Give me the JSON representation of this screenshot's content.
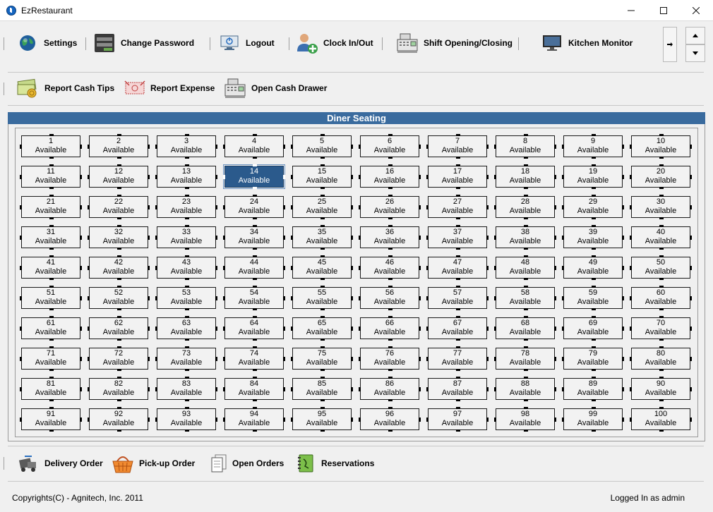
{
  "window": {
    "title": "EzRestaurant"
  },
  "toolbar1": [
    {
      "id": "settings",
      "label": "Settings",
      "icon": "globe-icon"
    },
    {
      "id": "change-password",
      "label": "Change Password",
      "icon": "password-panel-icon"
    },
    {
      "id": "logout",
      "label": "Logout",
      "icon": "monitor-power-icon"
    },
    {
      "id": "clock-in-out",
      "label": "Clock In/Out",
      "icon": "user-add-icon"
    },
    {
      "id": "shift",
      "label": "Shift Opening/Closing",
      "icon": "cash-register-icon"
    },
    {
      "id": "kitchen-monitor",
      "label": "Kitchen Monitor",
      "icon": "monitor-icon"
    }
  ],
  "toolbar2": [
    {
      "id": "report-cash-tips",
      "label": "Report Cash Tips",
      "icon": "cash-bills-icon"
    },
    {
      "id": "report-expense",
      "label": "Report Expense",
      "icon": "expense-bill-icon"
    },
    {
      "id": "open-cash-drawer",
      "label": "Open Cash Drawer",
      "icon": "cash-register-icon"
    }
  ],
  "seating": {
    "title": "Diner Seating",
    "status_label": "Available",
    "table_count": 100,
    "selected_table": 14
  },
  "toolbar3": [
    {
      "id": "delivery-order",
      "label": "Delivery Order",
      "icon": "delivery-icon"
    },
    {
      "id": "pickup-order",
      "label": "Pick-up Order",
      "icon": "basket-icon"
    },
    {
      "id": "open-orders",
      "label": "Open Orders",
      "icon": "documents-icon"
    },
    {
      "id": "reservations",
      "label": "Reservations",
      "icon": "notebook-icon"
    }
  ],
  "statusbar": {
    "copyright": "Copyrights(C) - Agnitech, Inc. 2011",
    "login": "Logged In as admin"
  },
  "colors": {
    "header": "#3a6b9e",
    "selected": "#2b5a8c"
  }
}
